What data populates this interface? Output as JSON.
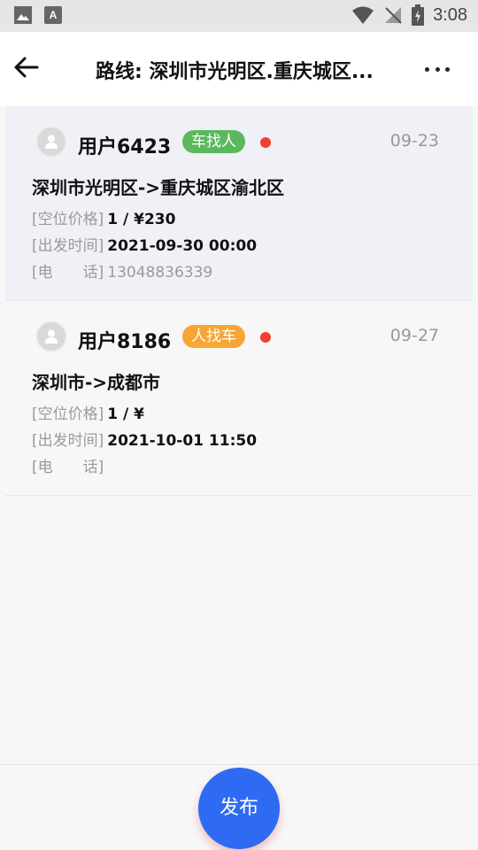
{
  "status_bar": {
    "time": "3:08",
    "left_icons": [
      "gallery-icon",
      "a-keyboard-icon"
    ],
    "right_icons": [
      "wifi-icon",
      "no-signal-icon",
      "battery-charging-icon"
    ]
  },
  "header": {
    "title": "路线: 深圳市光明区.重庆城区...",
    "back_icon": "arrow-left-icon",
    "more_icon": "more-dots-icon"
  },
  "posts": [
    {
      "username": "用户6423",
      "tag": "车找人",
      "tag_color": "#5bb85d",
      "date": "09-23",
      "route": "深圳市光明区->重庆城区渝北区",
      "seat_price_label": "[空位价格]",
      "seat_price_value": "1 / ¥230",
      "depart_label": "[出发时间]",
      "depart_value": "2021-09-30 00:00",
      "phone_label": "[电　　话]",
      "phone_value": "13048836339"
    },
    {
      "username": "用户8186",
      "tag": "人找车",
      "tag_color": "#f7a534",
      "date": "09-27",
      "route": "深圳市->成都市",
      "seat_price_label": "[空位价格]",
      "seat_price_value": "1 / ¥",
      "depart_label": "[出发时间]",
      "depart_value": "2021-10-01 11:50",
      "phone_label": "[电　　话]",
      "phone_value": ""
    }
  ],
  "publish_button": {
    "label": "发布",
    "color": "#2f6bf2"
  }
}
